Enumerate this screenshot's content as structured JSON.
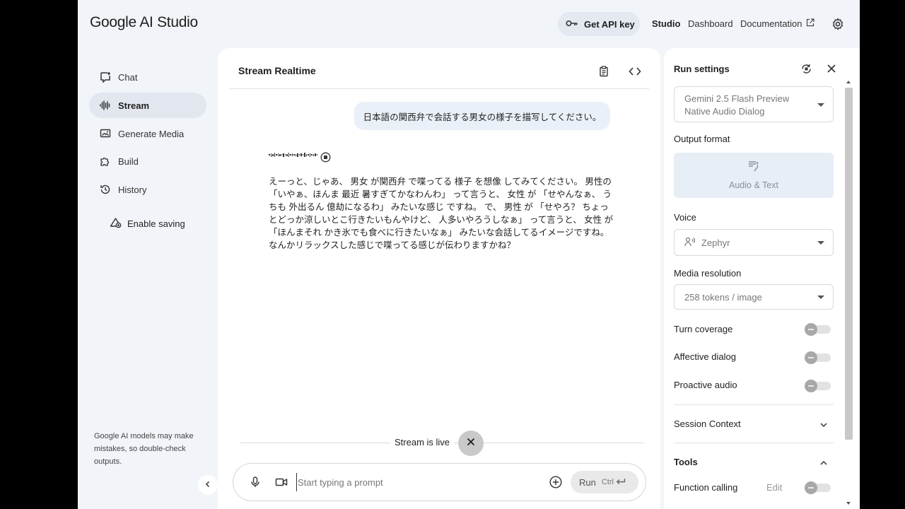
{
  "header": {
    "logo_google": "Google",
    "logo_rest": "AI Studio",
    "api_key_label": "Get API key",
    "nav_studio": "Studio",
    "nav_dashboard": "Dashboard",
    "nav_documentation": "Documentation"
  },
  "sidebar": {
    "items": [
      {
        "label": "Chat",
        "icon": "chat-icon"
      },
      {
        "label": "Stream",
        "icon": "waveform-icon",
        "active": true
      },
      {
        "label": "Generate Media",
        "icon": "media-icon"
      },
      {
        "label": "Build",
        "icon": "puzzle-icon"
      },
      {
        "label": "History",
        "icon": "history-icon"
      }
    ],
    "enable_saving": "Enable saving",
    "disclaimer": "Google AI models may make mistakes, so double-check outputs."
  },
  "main": {
    "title": "Stream Realtime",
    "user_message": "日本語の関西弁で会話する男女の様子を描写してください。",
    "model_reply": "えーっと、じゃあ、 男女 が関西弁 で喋ってる 様子 を想像 してみてください。 男性の 「いやぁ、ほんま 最近 暑すぎてかなわんわ」 って言うと、 女性 が 「せやんなぁ、 うちも 外出るん 億劫になるわ」 みたいな感じ ですね。 で、 男性 が 「せやろ？ ちょっとどっか涼しいとこ行きたいもんやけど、 人多いやろうしなぁ」 って言うと、 女性 が 「ほんまそれ かき氷でも食べに行きたいなぁ」 みたいな会話してるイメージですね。 なんかリラックスした感じで喋ってる感じが伝わりますかね？",
    "live_status": "Stream is live",
    "prompt_placeholder": "Start typing a prompt",
    "run_label": "Run",
    "run_shortcut": "Ctrl"
  },
  "settings": {
    "title": "Run settings",
    "model": "Gemini 2.5 Flash Preview Native Audio Dialog",
    "output_format_label": "Output format",
    "output_format_value": "Audio & Text",
    "voice_label": "Voice",
    "voice_value": "Zephyr",
    "media_resolution_label": "Media resolution",
    "media_resolution_value": "258 tokens / image",
    "turn_coverage": "Turn coverage",
    "affective_dialog": "Affective dialog",
    "proactive_audio": "Proactive audio",
    "session_context": "Session Context",
    "tools": "Tools",
    "function_calling": "Function calling",
    "edit": "Edit"
  }
}
